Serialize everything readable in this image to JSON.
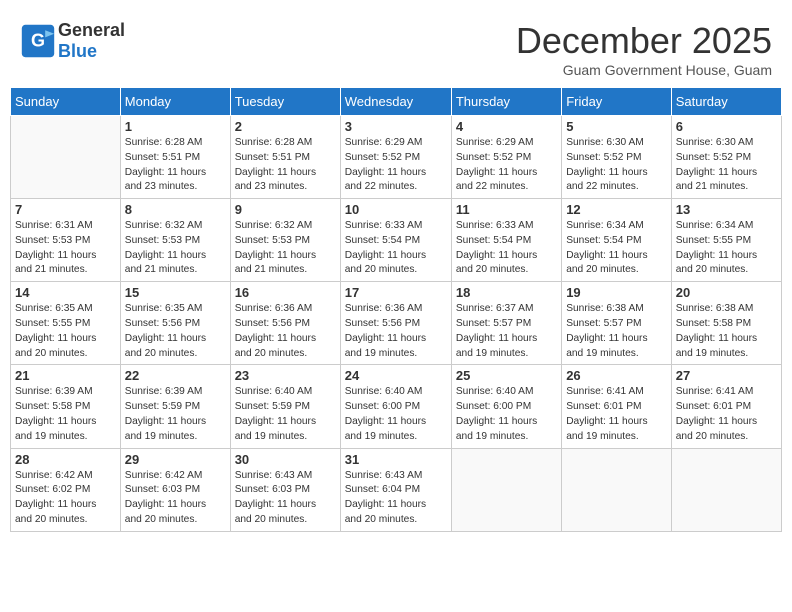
{
  "header": {
    "logo_general": "General",
    "logo_blue": "Blue",
    "title": "December 2025",
    "location": "Guam Government House, Guam"
  },
  "days_of_week": [
    "Sunday",
    "Monday",
    "Tuesday",
    "Wednesday",
    "Thursday",
    "Friday",
    "Saturday"
  ],
  "weeks": [
    [
      {
        "day": "",
        "info": ""
      },
      {
        "day": "1",
        "info": "Sunrise: 6:28 AM\nSunset: 5:51 PM\nDaylight: 11 hours\nand 23 minutes."
      },
      {
        "day": "2",
        "info": "Sunrise: 6:28 AM\nSunset: 5:51 PM\nDaylight: 11 hours\nand 23 minutes."
      },
      {
        "day": "3",
        "info": "Sunrise: 6:29 AM\nSunset: 5:52 PM\nDaylight: 11 hours\nand 22 minutes."
      },
      {
        "day": "4",
        "info": "Sunrise: 6:29 AM\nSunset: 5:52 PM\nDaylight: 11 hours\nand 22 minutes."
      },
      {
        "day": "5",
        "info": "Sunrise: 6:30 AM\nSunset: 5:52 PM\nDaylight: 11 hours\nand 22 minutes."
      },
      {
        "day": "6",
        "info": "Sunrise: 6:30 AM\nSunset: 5:52 PM\nDaylight: 11 hours\nand 21 minutes."
      }
    ],
    [
      {
        "day": "7",
        "info": "Sunrise: 6:31 AM\nSunset: 5:53 PM\nDaylight: 11 hours\nand 21 minutes."
      },
      {
        "day": "8",
        "info": "Sunrise: 6:32 AM\nSunset: 5:53 PM\nDaylight: 11 hours\nand 21 minutes."
      },
      {
        "day": "9",
        "info": "Sunrise: 6:32 AM\nSunset: 5:53 PM\nDaylight: 11 hours\nand 21 minutes."
      },
      {
        "day": "10",
        "info": "Sunrise: 6:33 AM\nSunset: 5:54 PM\nDaylight: 11 hours\nand 20 minutes."
      },
      {
        "day": "11",
        "info": "Sunrise: 6:33 AM\nSunset: 5:54 PM\nDaylight: 11 hours\nand 20 minutes."
      },
      {
        "day": "12",
        "info": "Sunrise: 6:34 AM\nSunset: 5:54 PM\nDaylight: 11 hours\nand 20 minutes."
      },
      {
        "day": "13",
        "info": "Sunrise: 6:34 AM\nSunset: 5:55 PM\nDaylight: 11 hours\nand 20 minutes."
      }
    ],
    [
      {
        "day": "14",
        "info": "Sunrise: 6:35 AM\nSunset: 5:55 PM\nDaylight: 11 hours\nand 20 minutes."
      },
      {
        "day": "15",
        "info": "Sunrise: 6:35 AM\nSunset: 5:56 PM\nDaylight: 11 hours\nand 20 minutes."
      },
      {
        "day": "16",
        "info": "Sunrise: 6:36 AM\nSunset: 5:56 PM\nDaylight: 11 hours\nand 20 minutes."
      },
      {
        "day": "17",
        "info": "Sunrise: 6:36 AM\nSunset: 5:56 PM\nDaylight: 11 hours\nand 19 minutes."
      },
      {
        "day": "18",
        "info": "Sunrise: 6:37 AM\nSunset: 5:57 PM\nDaylight: 11 hours\nand 19 minutes."
      },
      {
        "day": "19",
        "info": "Sunrise: 6:38 AM\nSunset: 5:57 PM\nDaylight: 11 hours\nand 19 minutes."
      },
      {
        "day": "20",
        "info": "Sunrise: 6:38 AM\nSunset: 5:58 PM\nDaylight: 11 hours\nand 19 minutes."
      }
    ],
    [
      {
        "day": "21",
        "info": "Sunrise: 6:39 AM\nSunset: 5:58 PM\nDaylight: 11 hours\nand 19 minutes."
      },
      {
        "day": "22",
        "info": "Sunrise: 6:39 AM\nSunset: 5:59 PM\nDaylight: 11 hours\nand 19 minutes."
      },
      {
        "day": "23",
        "info": "Sunrise: 6:40 AM\nSunset: 5:59 PM\nDaylight: 11 hours\nand 19 minutes."
      },
      {
        "day": "24",
        "info": "Sunrise: 6:40 AM\nSunset: 6:00 PM\nDaylight: 11 hours\nand 19 minutes."
      },
      {
        "day": "25",
        "info": "Sunrise: 6:40 AM\nSunset: 6:00 PM\nDaylight: 11 hours\nand 19 minutes."
      },
      {
        "day": "26",
        "info": "Sunrise: 6:41 AM\nSunset: 6:01 PM\nDaylight: 11 hours\nand 19 minutes."
      },
      {
        "day": "27",
        "info": "Sunrise: 6:41 AM\nSunset: 6:01 PM\nDaylight: 11 hours\nand 20 minutes."
      }
    ],
    [
      {
        "day": "28",
        "info": "Sunrise: 6:42 AM\nSunset: 6:02 PM\nDaylight: 11 hours\nand 20 minutes."
      },
      {
        "day": "29",
        "info": "Sunrise: 6:42 AM\nSunset: 6:03 PM\nDaylight: 11 hours\nand 20 minutes."
      },
      {
        "day": "30",
        "info": "Sunrise: 6:43 AM\nSunset: 6:03 PM\nDaylight: 11 hours\nand 20 minutes."
      },
      {
        "day": "31",
        "info": "Sunrise: 6:43 AM\nSunset: 6:04 PM\nDaylight: 11 hours\nand 20 minutes."
      },
      {
        "day": "",
        "info": ""
      },
      {
        "day": "",
        "info": ""
      },
      {
        "day": "",
        "info": ""
      }
    ]
  ]
}
